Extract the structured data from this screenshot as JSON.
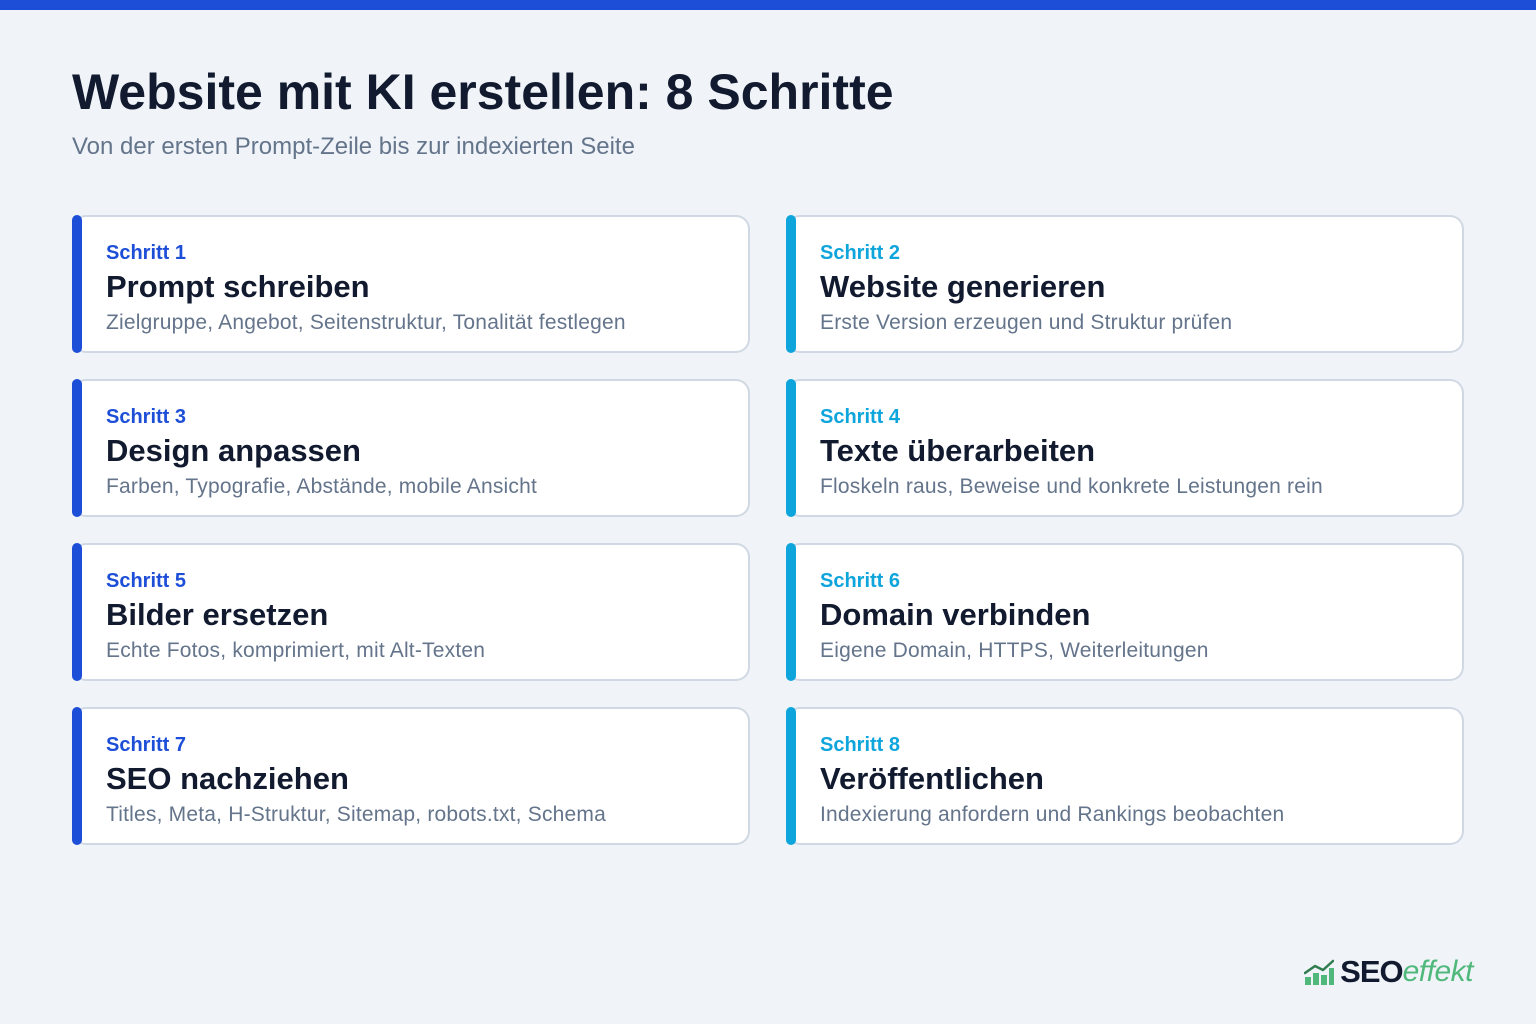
{
  "colors": {
    "topbar": "#1d4ed8",
    "left_accent": "#1d4ed8",
    "right_accent": "#0ea5dc",
    "logo_green": "#4fb87a"
  },
  "header": {
    "title": "Website mit KI erstellen: 8 Schritte",
    "subtitle": "Von der ersten Prompt-Zeile bis zur indexierten Seite"
  },
  "steps": [
    {
      "label": "Schritt 1",
      "title": "Prompt schreiben",
      "desc": "Zielgruppe, Angebot, Seitenstruktur, Tonalität festlegen"
    },
    {
      "label": "Schritt 2",
      "title": "Website generieren",
      "desc": "Erste Version erzeugen und Struktur prüfen"
    },
    {
      "label": "Schritt 3",
      "title": "Design anpassen",
      "desc": "Farben, Typografie, Abstände, mobile Ansicht"
    },
    {
      "label": "Schritt 4",
      "title": "Texte überarbeiten",
      "desc": "Floskeln raus, Beweise und konkrete Leistungen rein"
    },
    {
      "label": "Schritt 5",
      "title": "Bilder ersetzen",
      "desc": "Echte Fotos, komprimiert, mit Alt-Texten"
    },
    {
      "label": "Schritt 6",
      "title": "Domain verbinden",
      "desc": "Eigene Domain, HTTPS, Weiterleitungen"
    },
    {
      "label": "Schritt 7",
      "title": "SEO nachziehen",
      "desc": "Titles, Meta, H-Struktur, Sitemap, robots.txt, Schema"
    },
    {
      "label": "Schritt 8",
      "title": "Veröffentlichen",
      "desc": "Indexierung anfordern und Rankings beobachten"
    }
  ],
  "logo": {
    "icon": "bar-chart-trend-icon",
    "brand_bold": "SEO",
    "brand_italic": "effekt"
  }
}
